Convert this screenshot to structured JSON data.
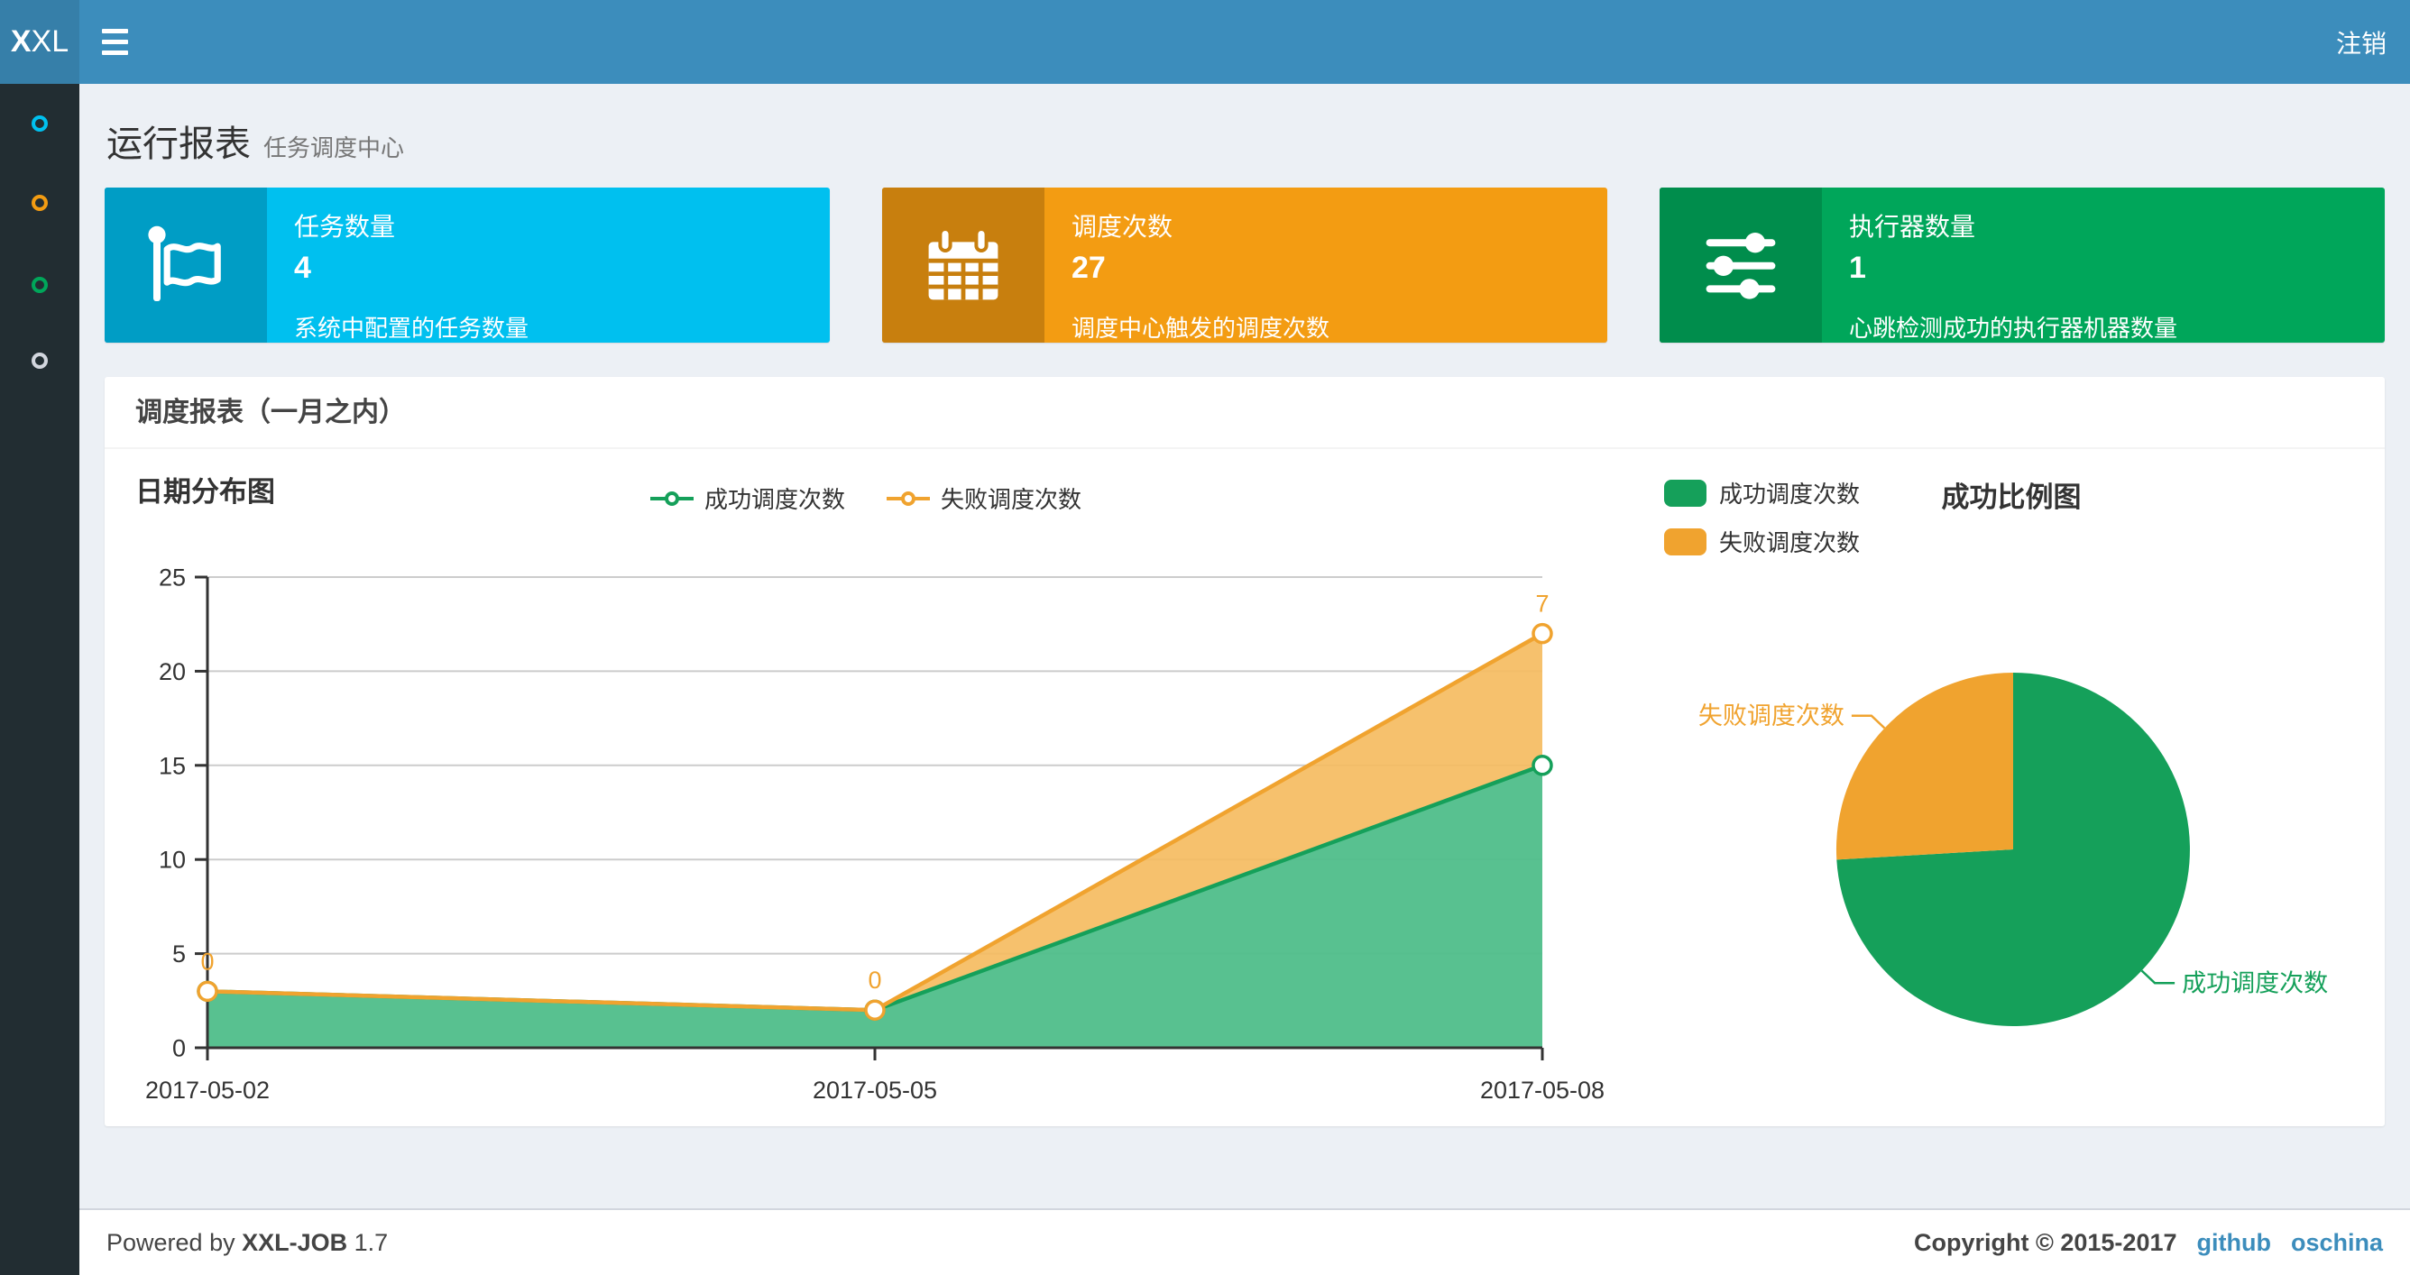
{
  "navbar": {
    "logo_bold": "X",
    "logo_rest": "XL",
    "logout_label": "注销"
  },
  "sidebar": {
    "items": [
      {
        "id": "menu-1",
        "icon": "circle-o-icon",
        "color": "#00c0ef"
      },
      {
        "id": "menu-2",
        "icon": "circle-o-icon",
        "color": "#f39c12"
      },
      {
        "id": "menu-3",
        "icon": "circle-o-icon",
        "color": "#00a65a"
      },
      {
        "id": "menu-4",
        "icon": "circle-o-icon",
        "color": "#d2d6de"
      }
    ]
  },
  "page_header": {
    "title": "运行报表",
    "subtitle": "任务调度中心"
  },
  "stat_cards": [
    {
      "title": "任务数量",
      "value": "4",
      "desc": "系统中配置的任务数量",
      "color": "#00c0ef",
      "icon_bg": "#009dc5",
      "icon": "flag-icon"
    },
    {
      "title": "调度次数",
      "value": "27",
      "desc": "调度中心触发的调度次数",
      "color": "#f39c12",
      "icon_bg": "#c87f0e",
      "icon": "calendar-icon"
    },
    {
      "title": "执行器数量",
      "value": "1",
      "desc": "心跳检测成功的执行器机器数量",
      "color": "#00a65a",
      "icon_bg": "#008d4c",
      "icon": "sliders-icon"
    }
  ],
  "panel": {
    "title": "调度报表（一月之内）"
  },
  "chart_data": [
    {
      "type": "area",
      "title": "日期分布图",
      "stacked": true,
      "x": [
        "2017-05-02",
        "2017-05-05",
        "2017-05-08"
      ],
      "series": [
        {
          "name": "成功调度次数",
          "values": [
            3,
            2,
            15
          ],
          "color": "#15A05A",
          "area_color": "#4FBE8A"
        },
        {
          "name": "失败调度次数",
          "values": [
            0,
            0,
            7
          ],
          "color": "#F0A32F",
          "area_color": "#F5BC61"
        }
      ],
      "point_labels": [
        null,
        [
          "0",
          "0",
          "7"
        ]
      ],
      "ylim": [
        0,
        25
      ],
      "yticks": [
        0,
        5,
        10,
        15,
        20,
        25
      ],
      "grid": true,
      "legend_position": "top-center"
    },
    {
      "type": "pie",
      "title": "成功比例图",
      "slices": [
        {
          "label": "成功调度次数",
          "value": 20,
          "color": "#15A05A"
        },
        {
          "label": "失败调度次数",
          "value": 7,
          "color": "#F0A32F"
        }
      ],
      "legend": [
        "成功调度次数",
        "失败调度次数"
      ]
    }
  ],
  "footer": {
    "powered_prefix": "Powered by",
    "brand": "XXL-JOB",
    "version": "1.7",
    "copyright": "Copyright © 2015-2017",
    "links": [
      "github",
      "oschina"
    ]
  }
}
